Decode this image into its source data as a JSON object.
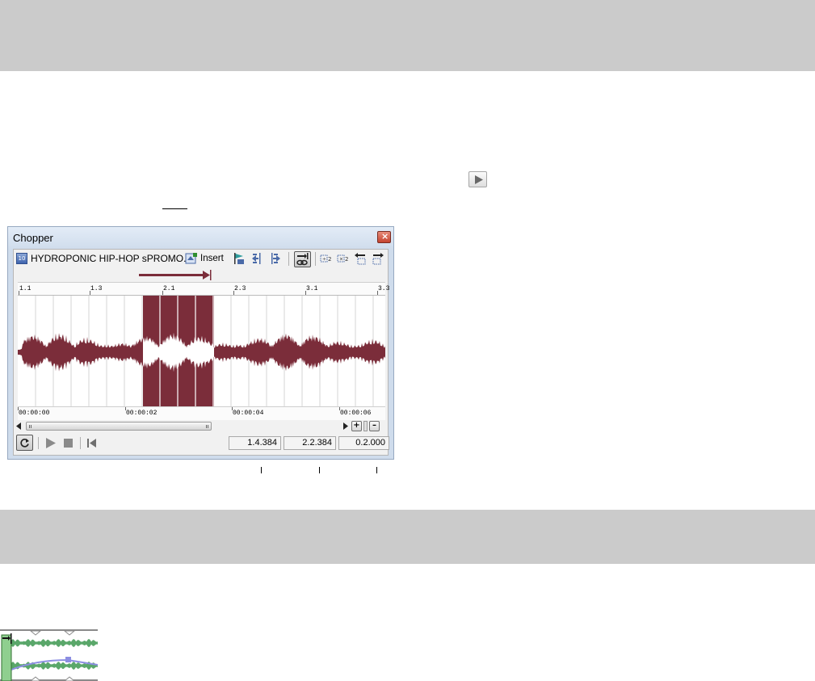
{
  "colors": {
    "band": "#cbcbcb",
    "waveform": "#7b2d3a",
    "selection": "#7b2d3a",
    "thumb_wave": "#5aa76a",
    "thumb_env": "#8c8ee2"
  },
  "chopper": {
    "title": "Chopper",
    "close_glyph": "×",
    "clip_badge": "10",
    "clip_name": "HYDROPONIC HIP-HOP sPROMO...",
    "insert_label": "Insert",
    "marker_ticks": [
      "1.1",
      "1.3",
      "2.1",
      "2.3",
      "3.1",
      "3.3"
    ],
    "time_ticks": [
      "00:00:00",
      "00:00:02",
      "00:00:04",
      "00:00:06"
    ],
    "readouts": {
      "selection_start": "1.4.384",
      "selection_end": "2.2.384",
      "selection_length": "0.2.000"
    },
    "zoom_in_label": "+",
    "zoom_out_label": "–"
  },
  "icons": {
    "play_button_small": "play-icon",
    "clip_badge": "audio-clip-icon",
    "insert": "insert-icon",
    "add_marker": "add-marker-icon",
    "previous": "move-selection-left-icon",
    "next": "move-selection-right-icon",
    "link": "link-arrow-selection-icon",
    "extend_left": "halve-selection-icon",
    "extend_right": "double-selection-icon",
    "shift_left": "shift-selection-left-icon",
    "shift_right": "shift-selection-right-icon",
    "loop": "loop-icon",
    "play": "play-icon",
    "stop": "stop-icon",
    "go_start": "go-to-start-icon"
  }
}
